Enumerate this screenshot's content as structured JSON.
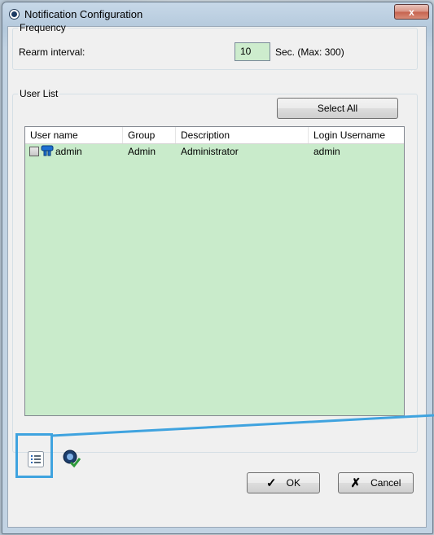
{
  "window": {
    "title": "Notification Configuration",
    "close_glyph": "x"
  },
  "frequency": {
    "legend": "Frequency",
    "rearm_label": "Rearm interval:",
    "rearm_value": "10",
    "rearm_hint": "Sec. (Max: 300)"
  },
  "user_list": {
    "legend": "User List",
    "select_all_label": "Select All",
    "columns": [
      "User name",
      "Group",
      "Description",
      "Login Username"
    ],
    "rows": [
      {
        "user_name": "admin",
        "group": "Admin",
        "description": "Administrator",
        "login_username": "admin",
        "checked": false
      }
    ]
  },
  "toolbar": {
    "icons": [
      "list-view-icon",
      "user-check-icon"
    ]
  },
  "footer": {
    "ok_label": "OK",
    "cancel_label": "Cancel"
  },
  "colors": {
    "list_background": "#c9ebcb",
    "highlight": "#3fa3df",
    "input_background": "#cdeccd"
  }
}
